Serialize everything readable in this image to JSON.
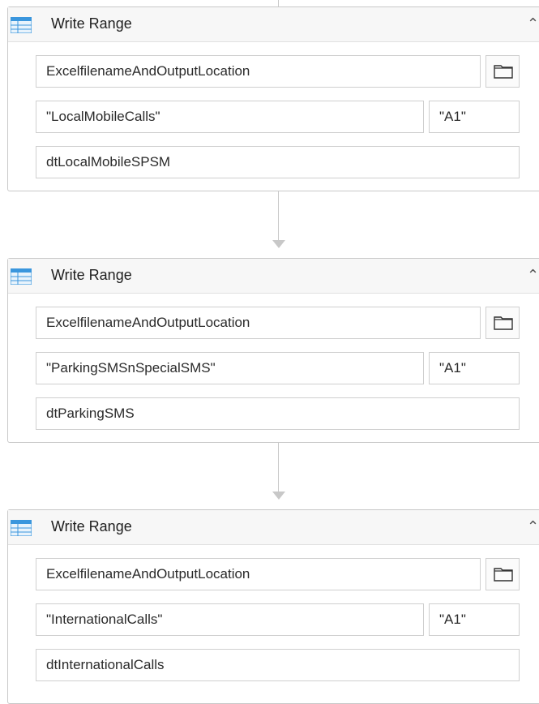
{
  "activities": [
    {
      "title": "Write Range",
      "workbook_path": "ExcelfilenameAndOutputLocation",
      "sheet_name": "\"LocalMobileCalls\"",
      "range": "\"A1\"",
      "data_table": "dtLocalMobileSPSM"
    },
    {
      "title": "Write Range",
      "workbook_path": "ExcelfilenameAndOutputLocation",
      "sheet_name": "\"ParkingSMSnSpecialSMS\"",
      "range": "\"A1\"",
      "data_table": "dtParkingSMS"
    },
    {
      "title": "Write Range",
      "workbook_path": "ExcelfilenameAndOutputLocation",
      "sheet_name": "\"InternationalCalls\"",
      "range": "\"A1\"",
      "data_table": "dtInternationalCalls"
    }
  ],
  "icons": {
    "header_icon": "excel-table-icon",
    "collapse_icon": "double-chevron-up-icon",
    "browse_icon": "folder-icon"
  },
  "colors": {
    "connector": "#c8c8c8",
    "table_icon_blue": "#3a96dd",
    "border": "#cfcfcf"
  }
}
